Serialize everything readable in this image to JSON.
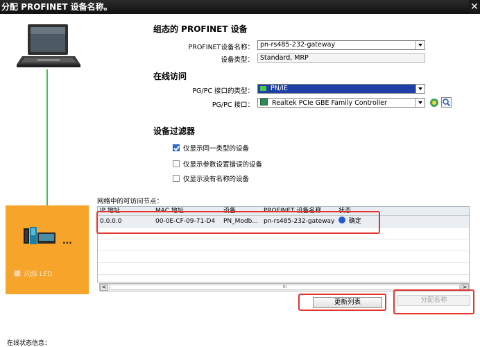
{
  "window": {
    "title": "分配 PROFINET 设备名称。",
    "close_label": "✕"
  },
  "configured": {
    "heading": "组态的 PROFINET 设备",
    "device_name_label": "PROFINET设备名称：",
    "device_name_value": "pn-rs485-232-gateway",
    "device_type_label": "设备类型：",
    "device_type_value": "Standard, MRP"
  },
  "online": {
    "heading": "在线访问",
    "interface_type_label": "PG/PC 接口的类型：",
    "interface_type_value": "PN/IE",
    "interface_label": "PG/PC 接口：",
    "interface_value": "Realtek PCIe GBE Family Controller"
  },
  "filter": {
    "heading": "设备过滤器",
    "options": [
      {
        "label": "仅显示同一类型的设备",
        "checked": true
      },
      {
        "label": "仅显示参数设置错误的设备",
        "checked": false
      },
      {
        "label": "仅显示没有名称的设备",
        "checked": false
      }
    ]
  },
  "table": {
    "caption": "网络中的可访问节点：",
    "headers": [
      "IP 地址",
      "MAC 地址",
      "设备",
      "PROFINET 设备名称",
      "状态"
    ],
    "rows": [
      {
        "ip": "0.0.0.0",
        "mac": "00-0E-CF-09-71-D4",
        "device": "PN_Modb...",
        "name": "pn-rs485-232-gateway",
        "status": "确定"
      }
    ]
  },
  "scrollbar": {
    "left": "<",
    "right": ">",
    "grip": "III"
  },
  "buttons": {
    "refresh": "更新列表",
    "assign": "分配名称"
  },
  "device_panel": {
    "flash_label": "闪烁 LED",
    "dots": "..."
  },
  "footer": {
    "status_label": "在线状态信息："
  },
  "colors": {
    "accent": "#1e3fa8",
    "highlight": "#e3342f",
    "panel": "#f7a42a",
    "link": "#2ecc40"
  }
}
